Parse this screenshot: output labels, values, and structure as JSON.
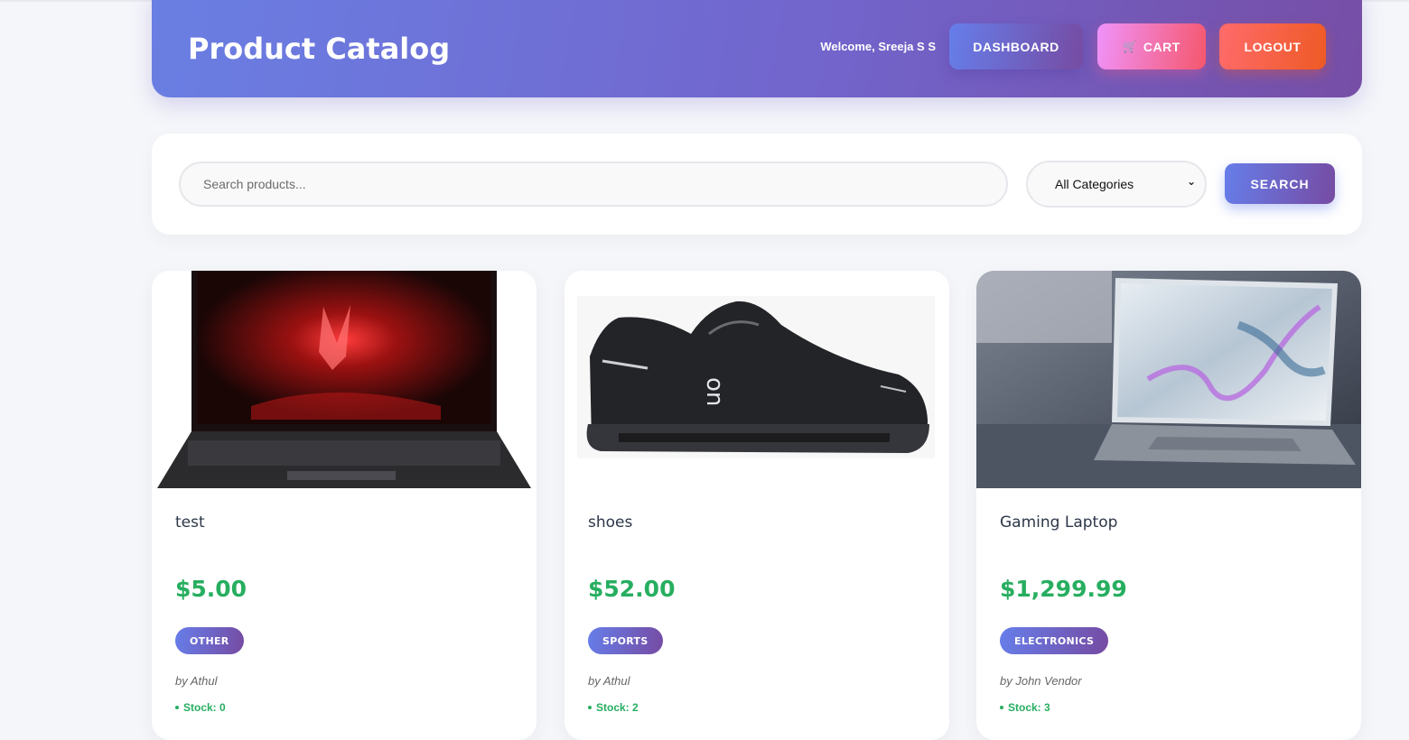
{
  "header": {
    "title": "Product Catalog",
    "welcome": "Welcome, Sreeja S S",
    "dashboard_label": "DASHBOARD",
    "cart_label": "CART",
    "cart_icon": "shopping-cart-icon",
    "logout_label": "LOGOUT"
  },
  "search": {
    "placeholder": "Search products...",
    "value": "",
    "category_selected": "All Categories",
    "button_label": "SEARCH"
  },
  "products": [
    {
      "name": "test",
      "price": "$5.00",
      "category": "OTHER",
      "vendor": "by Athul",
      "stock": "Stock: 0",
      "image": "laptop-red-glow"
    },
    {
      "name": "shoes",
      "price": "$52.00",
      "category": "SPORTS",
      "vendor": "by Athul",
      "stock": "Stock: 2",
      "image": "black-running-shoe"
    },
    {
      "name": "Gaming Laptop",
      "price": "$1,299.99",
      "category": "ELECTRONICS",
      "vendor": "by John Vendor",
      "stock": "Stock: 3",
      "image": "laptop-marble-wallpaper"
    }
  ],
  "colors": {
    "header_gradient_start": "#667eea",
    "header_gradient_end": "#764ba2",
    "price_green": "#27ae60",
    "cart_gradient_start": "#f093fb",
    "cart_gradient_end": "#f5576c",
    "logout_gradient_start": "#ff6b6b",
    "logout_gradient_end": "#ee5a24"
  }
}
